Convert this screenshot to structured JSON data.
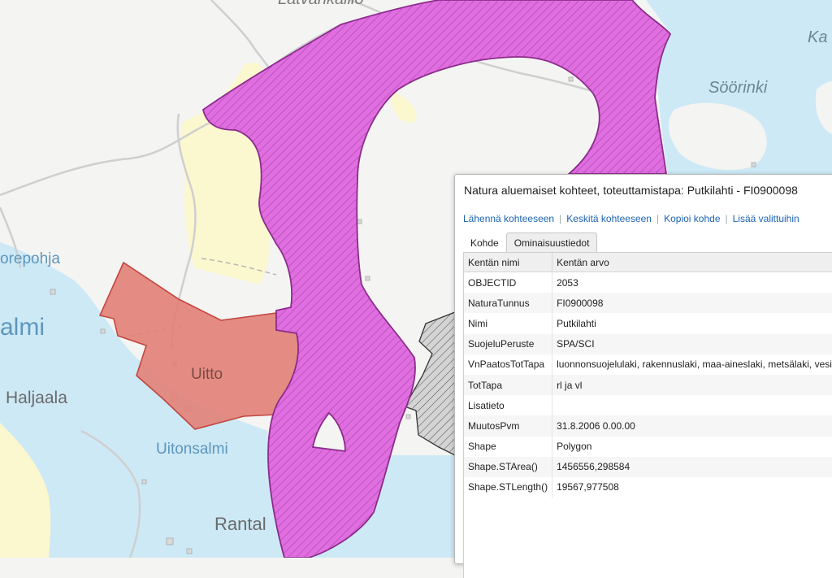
{
  "map": {
    "colors": {
      "water": "#cde9f6",
      "land": "#f4f4f2",
      "field": "#fbf7cf",
      "road": "#cfcfcf",
      "natura": "#e06ee0",
      "natura_stroke": "#8a2a8a",
      "red_area": "#e2827a",
      "red_stroke": "#c2463f",
      "gray_area": "#d4d4d4"
    },
    "labels": [
      {
        "text": "Latvankallio"
      },
      {
        "text": "Ka"
      },
      {
        "text": "Söörinki"
      },
      {
        "text": "orepohja"
      },
      {
        "text": "almi"
      },
      {
        "text": "Uitto"
      },
      {
        "text": "Haljaala"
      },
      {
        "text": "Uitonsalmi"
      },
      {
        "text": "Rantal"
      }
    ]
  },
  "popup": {
    "title": "Natura aluemaiset kohteet, toteuttamistapa: Putkilahti - FI0900098",
    "links": [
      "Lähennä kohteeseen",
      "Keskitä kohteeseen",
      "Kopioi kohde",
      "Lisää valittuihin"
    ],
    "tabs": [
      {
        "label": "Kohde",
        "active": false
      },
      {
        "label": "Ominaisuustiedot",
        "active": true
      }
    ],
    "table": {
      "headers": [
        "Kentän nimi",
        "Kentän arvo"
      ],
      "rows": [
        {
          "name": "OBJECTID",
          "value": "2053"
        },
        {
          "name": "NaturaTunnus",
          "value": "FI0900098"
        },
        {
          "name": "Nimi",
          "value": "Putkilahti"
        },
        {
          "name": "SuojeluPeruste",
          "value": "SPA/SCI"
        },
        {
          "name": "VnPaatosTotTapa",
          "value": "luonnonsuojelulaki, rakennuslaki, maa-aineslaki, metsälaki, vesilaki"
        },
        {
          "name": "TotTapa",
          "value": "rl ja vl"
        },
        {
          "name": "Lisatieto",
          "value": ""
        },
        {
          "name": "MuutosPvm",
          "value": "31.8.2006 0.00.00"
        },
        {
          "name": "Shape",
          "value": "Polygon"
        },
        {
          "name": "Shape.STArea()",
          "value": "1456556,298584"
        },
        {
          "name": "Shape.STLength()",
          "value": "19567,977508"
        }
      ]
    }
  }
}
